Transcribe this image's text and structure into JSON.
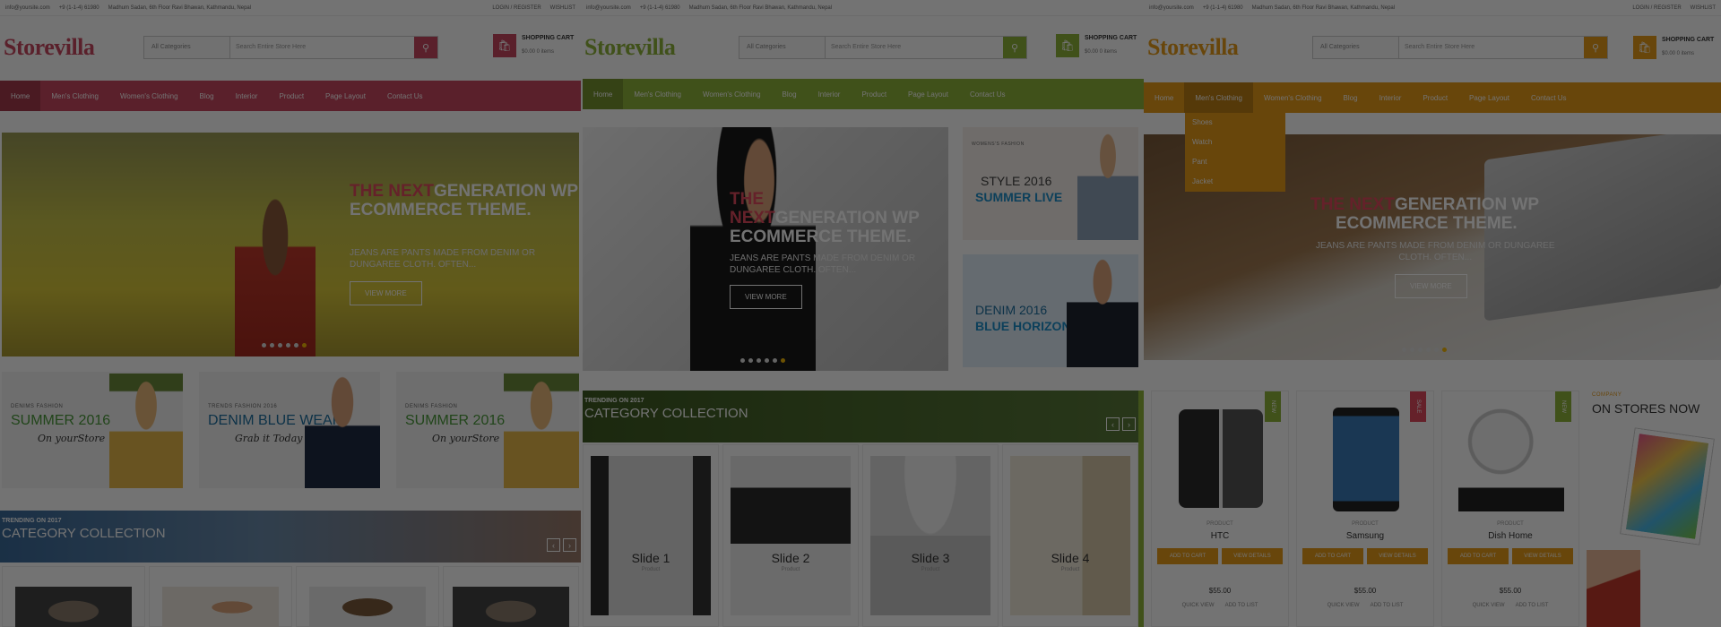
{
  "p1": {
    "topbar": {
      "email": "info@yoursite.com",
      "phone": "+9 (1-1-4) 61980",
      "address": "Madhum Sadan, 6th Floor Ravi Bhawan, Kathmandu, Nepal",
      "login": "LOGIN / REGISTER",
      "wishlist": "WISHLIST"
    },
    "logo": "Storevilla",
    "search": {
      "category": "All Categories",
      "placeholder": "Search Entire Store Here"
    },
    "cart": {
      "title": "SHOPPING CART",
      "sub": "$0.00 0 items"
    },
    "nav": [
      "Home",
      "Men's Clothing",
      "Women's Clothing",
      "Blog",
      "Interior",
      "Product",
      "Page Layout",
      "Contact Us"
    ],
    "slide": {
      "hl": "THE NEXT",
      "title1": "GENERATION WP",
      "title2": "ECOMMERCE THEME.",
      "sub1": "JEANS ARE PANTS MADE FROM DENIM OR",
      "sub2": "DUNGAREE CLOTH. OFTEN...",
      "btn": "VIEW MORE"
    },
    "banners": [
      {
        "small": "DENIMS FASHION",
        "big": "SUMMER 2016",
        "script": "On yourStore"
      },
      {
        "small": "TRENDS FASHION 2016",
        "big": "DENIM BLUE WEAR",
        "script": "Grab it Today"
      },
      {
        "small": "DENIMS FASHION",
        "big": "SUMMER 2016",
        "script": "On yourStore"
      }
    ],
    "catbar": {
      "small": "TRENDING ON 2017",
      "title": "CATEGORY COLLECTION"
    }
  },
  "p2": {
    "topbar": {
      "email": "info@yoursite.com",
      "phone": "+9 (1-1-4) 61980",
      "address": "Madhum Sadan, 6th Floor Ravi Bhawan, Kathmandu, Nepal",
      "login": "LOGIN / REGISTER",
      "wishlist": "WISHLIST"
    },
    "logo": "Storevilla",
    "search": {
      "category": "All Categories",
      "placeholder": "Search Entire Store Here"
    },
    "cart": {
      "title": "SHOPPING CART",
      "sub": "$0.00 0 items"
    },
    "nav": [
      "Home",
      "Men's Clothing",
      "Women's Clothing",
      "Blog",
      "Interior",
      "Product",
      "Page Layout",
      "Contact Us"
    ],
    "slide": {
      "hl1": "THE",
      "hl2": "NEXT",
      "title1": "GENERATION WP",
      "title2": "ECOMMERCE THEME.",
      "sub1": "JEANS ARE PANTS MADE FROM DENIM OR",
      "sub2": "DUNGAREE CLOTH. OFTEN...",
      "btn": "VIEW MORE"
    },
    "sideBanners": [
      {
        "small": "WOMENS'S FASHION",
        "big1": "STYLE 2016",
        "big2": "SUMMER LIVE"
      },
      {
        "small": "",
        "big1": "DENIM 2016",
        "big2": "BLUE HORIZON"
      }
    ],
    "catbar": {
      "small": "TRENDING ON 2017",
      "title": "CATEGORY COLLECTION"
    },
    "slides": [
      {
        "label": "Slide 1",
        "sub": "Product"
      },
      {
        "label": "Slide 2",
        "sub": "Product"
      },
      {
        "label": "Slide 3",
        "sub": "Product"
      },
      {
        "label": "Slide 4",
        "sub": "Product"
      }
    ]
  },
  "p3": {
    "topbar": {
      "email": "info@yoursite.com",
      "phone": "+9 (1-1-4) 61980",
      "address": "Madhum Sadan, 6th Floor Ravi Bhawan, Kathmandu, Nepal",
      "login": "LOGIN / REGISTER",
      "wishlist": "WISHLIST"
    },
    "logo": "Storevilla",
    "search": {
      "category": "All Categories",
      "placeholder": "Search Entire Store Here"
    },
    "cart": {
      "title": "SHOPPING CART",
      "sub": "$0.00 0 items"
    },
    "nav": [
      "Home",
      "Men's Clothing",
      "Women's Clothing",
      "Blog",
      "Interior",
      "Product",
      "Page Layout",
      "Contact Us"
    ],
    "dropdown": [
      "Shoes",
      "Watch",
      "Pant",
      "Jacket"
    ],
    "slide": {
      "hl": "THE NEXT",
      "title1": "GENERATION WP",
      "title2": "ECOMMERCE THEME.",
      "sub1": "JEANS ARE PANTS MADE FROM DENIM OR DUNGAREE",
      "sub2": "CLOTH. OFTEN...",
      "btn": "VIEW MORE"
    },
    "products": [
      {
        "badge": "NEW",
        "cat": "PRODUCT",
        "name": "HTC",
        "add": "ADD TO CART",
        "view": "VIEW DETAILS",
        "price": "$55.00",
        "quick": "QUICK VIEW",
        "wish": "ADD TO LIST"
      },
      {
        "badge": "SALE",
        "cat": "PRODUCT",
        "name": "Samsung",
        "add": "ADD TO CART",
        "view": "VIEW DETAILS",
        "price": "$55.00",
        "quick": "QUICK VIEW",
        "wish": "ADD TO LIST"
      },
      {
        "badge": "NEW",
        "cat": "PRODUCT",
        "name": "Dish Home",
        "add": "ADD TO CART",
        "view": "VIEW DETAILS",
        "price": "$55.00",
        "quick": "QUICK VIEW",
        "wish": "ADD TO LIST"
      }
    ],
    "promo": {
      "small": "COMPANY",
      "title": "ON STORES NOW"
    }
  },
  "colors": {
    "pink": "#c8475f",
    "green": "#8fb33a",
    "orange": "#e69b1a",
    "red": "#e0495e",
    "blue": "#1e8fc9"
  }
}
